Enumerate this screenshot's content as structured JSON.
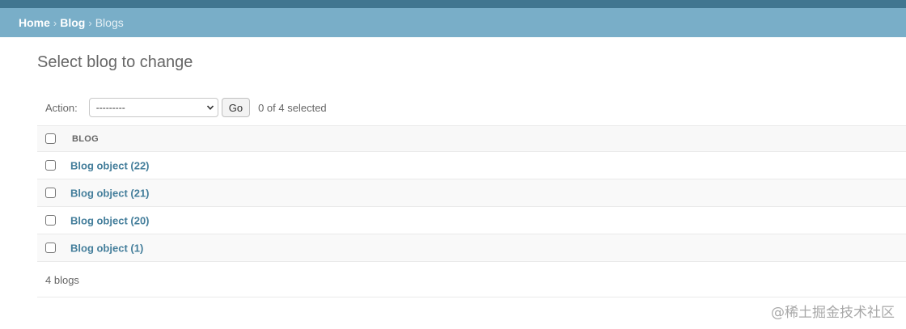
{
  "breadcrumbs": {
    "home": "Home",
    "sep1": "›",
    "blog": "Blog",
    "sep2": "›",
    "current": "Blogs"
  },
  "page_title": "Select blog to change",
  "actions": {
    "label": "Action:",
    "selected_option": "---------",
    "go_label": "Go",
    "selected_count": "0 of 4 selected"
  },
  "table": {
    "column_header": "BLOG",
    "rows": [
      {
        "label": "Blog object (22)"
      },
      {
        "label": "Blog object (21)"
      },
      {
        "label": "Blog object (20)"
      },
      {
        "label": "Blog object (1)"
      }
    ]
  },
  "paginator": "4 blogs",
  "watermark": "@稀土掘金技术社区",
  "colors": {
    "topbar": "#417690",
    "breadcrumbs_bg": "#79aec8",
    "link": "#447e9b"
  }
}
